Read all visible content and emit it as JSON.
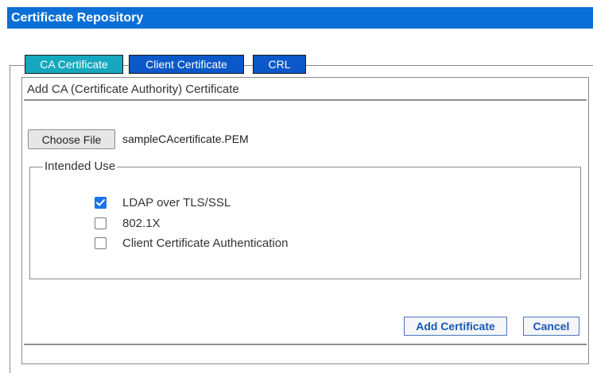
{
  "window": {
    "title": "Certificate Repository"
  },
  "tabs": [
    {
      "label": "CA Certificate",
      "active": true
    },
    {
      "label": "Client Certificate",
      "active": false
    },
    {
      "label": "CRL",
      "active": false
    }
  ],
  "panel": {
    "heading": "Add CA (Certificate Authority) Certificate",
    "file_picker": {
      "button_label": "Choose File",
      "selected_file": "sampleCAcertificate.PEM"
    },
    "intended_use": {
      "legend": "Intended Use",
      "options": [
        {
          "label": "LDAP over TLS/SSL",
          "checked": true
        },
        {
          "label": "802.1X",
          "checked": false
        },
        {
          "label": "Client Certificate Authentication",
          "checked": false
        }
      ]
    },
    "actions": {
      "add_label": "Add Certificate",
      "cancel_label": "Cancel"
    }
  },
  "colors": {
    "title_bar": "#0a6fd6",
    "tab_active": "#15a8bf",
    "tab_inactive": "#0b58c9",
    "checkbox_checked": "#1a73e8",
    "action_text": "#1757b5"
  }
}
